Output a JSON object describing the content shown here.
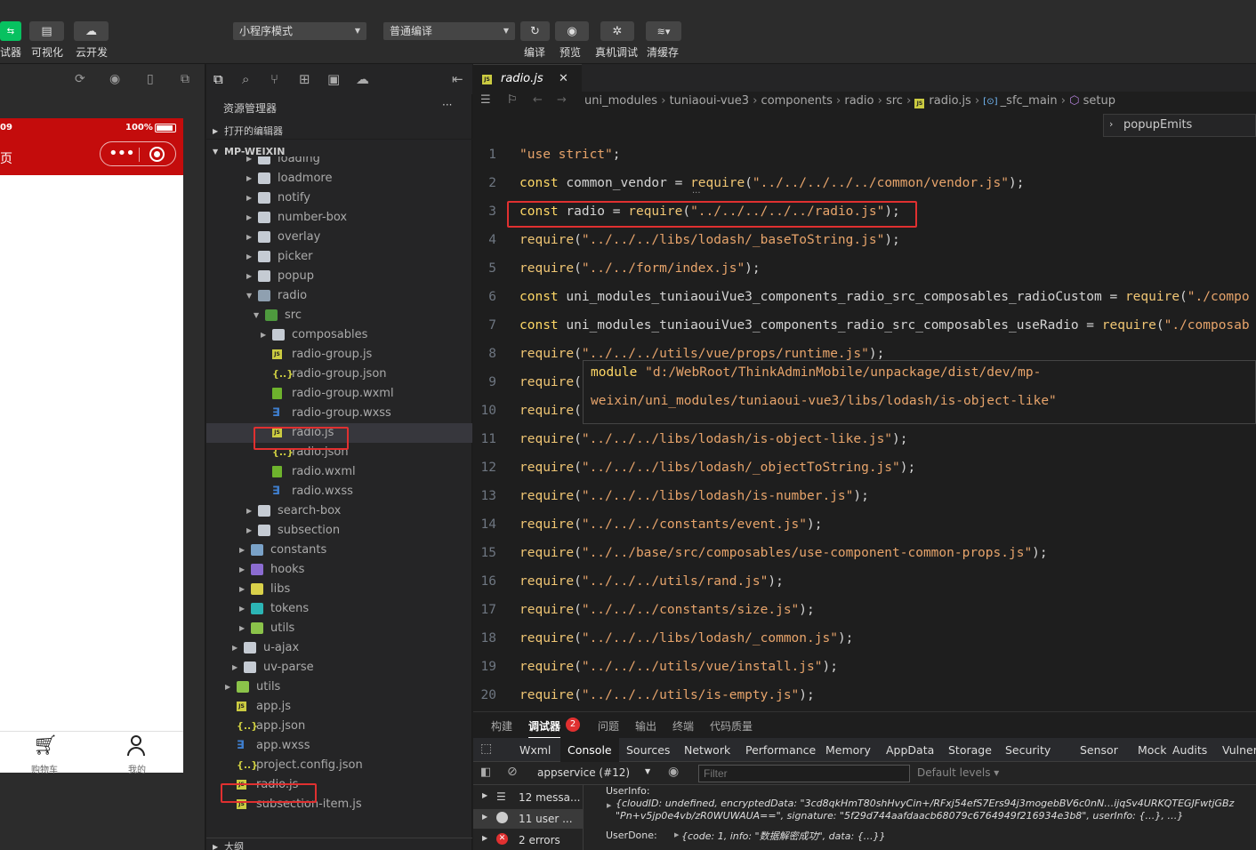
{
  "toolbar": {
    "left_cut_label": "试器",
    "visual_label": "可视化",
    "cloud_label": "云开发",
    "mode_select": "小程序模式",
    "compile_select": "普通编译",
    "compile_label": "编译",
    "preview_label": "预览",
    "remote_debug_label": "真机调试",
    "clear_cache_label": "清缓存"
  },
  "simulator": {
    "time": "09",
    "battery": "100%",
    "page_title": "页",
    "tab_cart_label": "购物车",
    "tab_mine_label": "我的"
  },
  "explorer": {
    "title": "资源管理器",
    "more": "···",
    "open_editors": "打开的编辑器",
    "root": "MP-WEIXIN",
    "items": [
      {
        "label": "loading",
        "type": "folder"
      },
      {
        "label": "loadmore",
        "type": "folder"
      },
      {
        "label": "notify",
        "type": "folder"
      },
      {
        "label": "number-box",
        "type": "folder"
      },
      {
        "label": "overlay",
        "type": "folder"
      },
      {
        "label": "picker",
        "type": "folder"
      },
      {
        "label": "popup",
        "type": "folder"
      },
      {
        "label": "radio",
        "type": "folder-open"
      },
      {
        "label": "src",
        "type": "folder-src"
      },
      {
        "label": "composables",
        "type": "folder"
      },
      {
        "label": "radio-group.js",
        "type": "js"
      },
      {
        "label": "radio-group.json",
        "type": "json"
      },
      {
        "label": "radio-group.wxml",
        "type": "wxml"
      },
      {
        "label": "radio-group.wxss",
        "type": "wxss"
      },
      {
        "label": "radio.js",
        "type": "js"
      },
      {
        "label": "radio.json",
        "type": "json"
      },
      {
        "label": "radio.wxml",
        "type": "wxml"
      },
      {
        "label": "radio.wxss",
        "type": "wxss"
      },
      {
        "label": "search-box",
        "type": "folder"
      },
      {
        "label": "subsection",
        "type": "folder"
      },
      {
        "label": "constants",
        "type": "folder-comp"
      },
      {
        "label": "hooks",
        "type": "folder-hooks"
      },
      {
        "label": "libs",
        "type": "folder-libs"
      },
      {
        "label": "tokens",
        "type": "folder-tokens"
      },
      {
        "label": "utils",
        "type": "folder-utils"
      },
      {
        "label": "u-ajax",
        "type": "folder"
      },
      {
        "label": "uv-parse",
        "type": "folder"
      },
      {
        "label": "utils",
        "type": "folder-utils"
      },
      {
        "label": "app.js",
        "type": "js"
      },
      {
        "label": "app.json",
        "type": "json"
      },
      {
        "label": "app.wxss",
        "type": "wxss"
      },
      {
        "label": "project.config.json",
        "type": "json"
      },
      {
        "label": "radio.js",
        "type": "js"
      },
      {
        "label": "subsection-item.js",
        "type": "js"
      }
    ],
    "bottom_section": "大纲"
  },
  "editor": {
    "tab_label": "radio.js",
    "tab_close": "✕",
    "breadcrumb": [
      "uni_modules",
      "tuniaoui-vue3",
      "components",
      "radio",
      "src",
      "radio.js",
      "_sfc_main",
      "setup"
    ],
    "peek_label": "popupEmits",
    "lines": [
      {
        "n": "1",
        "parts": [
          [
            "st",
            "\"use strict\""
          ],
          [
            "",
            ";"
          ]
        ]
      },
      {
        "n": "2",
        "parts": [
          [
            "kw",
            "const "
          ],
          [
            "",
            "common_vendor = "
          ],
          [
            "fn",
            "require"
          ],
          [
            "",
            "("
          ],
          [
            "st",
            "\"../../../../../common/vendor.js\""
          ],
          [
            "",
            ");"
          ]
        ]
      },
      {
        "n": "3",
        "parts": [
          [
            "kw",
            "const "
          ],
          [
            "",
            "radio = "
          ],
          [
            "fn",
            "require"
          ],
          [
            "",
            "("
          ],
          [
            "st",
            "\"../../../../../radio.js\""
          ],
          [
            "",
            ");"
          ]
        ]
      },
      {
        "n": "4",
        "parts": [
          [
            "fn",
            "require"
          ],
          [
            "",
            "("
          ],
          [
            "st",
            "\"../../../libs/lodash/_baseToString.js\""
          ],
          [
            "",
            ");"
          ]
        ]
      },
      {
        "n": "5",
        "parts": [
          [
            "fn",
            "require"
          ],
          [
            "",
            "("
          ],
          [
            "st",
            "\"../../form/index.js\""
          ],
          [
            "",
            ");"
          ]
        ]
      },
      {
        "n": "6",
        "parts": [
          [
            "kw",
            "const "
          ],
          [
            "",
            "uni_modules_tuniaouiVue3_components_radio_src_composables_radioCustom = "
          ],
          [
            "fn",
            "require"
          ],
          [
            "",
            "("
          ],
          [
            "st",
            "\"./compo"
          ]
        ]
      },
      {
        "n": "7",
        "parts": [
          [
            "kw",
            "const "
          ],
          [
            "",
            "uni_modules_tuniaouiVue3_components_radio_src_composables_useRadio = "
          ],
          [
            "fn",
            "require"
          ],
          [
            "",
            "("
          ],
          [
            "st",
            "\"./composab"
          ]
        ]
      },
      {
        "n": "8",
        "parts": [
          [
            "fn",
            "require"
          ],
          [
            "",
            "("
          ],
          [
            "st",
            "\"../../../utils/vue/props/runtime.js\""
          ],
          [
            "",
            ");"
          ]
        ]
      },
      {
        "n": "9",
        "parts": [
          [
            "fn",
            "require"
          ],
          [
            "",
            "("
          ]
        ]
      },
      {
        "n": "10",
        "parts": [
          [
            "fn",
            "require"
          ],
          [
            "",
            "("
          ]
        ]
      },
      {
        "n": "11",
        "parts": [
          [
            "fn",
            "require"
          ],
          [
            "",
            "("
          ],
          [
            "st",
            "\"../../../libs/lodash/is-object-like.js\""
          ],
          [
            "",
            ");"
          ]
        ]
      },
      {
        "n": "12",
        "parts": [
          [
            "fn",
            "require"
          ],
          [
            "",
            "("
          ],
          [
            "st",
            "\"../../../libs/lodash/_objectToString.js\""
          ],
          [
            "",
            ");"
          ]
        ]
      },
      {
        "n": "13",
        "parts": [
          [
            "fn",
            "require"
          ],
          [
            "",
            "("
          ],
          [
            "st",
            "\"../../../libs/lodash/is-number.js\""
          ],
          [
            "",
            ");"
          ]
        ]
      },
      {
        "n": "14",
        "parts": [
          [
            "fn",
            "require"
          ],
          [
            "",
            "("
          ],
          [
            "st",
            "\"../../../constants/event.js\""
          ],
          [
            "",
            ");"
          ]
        ]
      },
      {
        "n": "15",
        "parts": [
          [
            "fn",
            "require"
          ],
          [
            "",
            "("
          ],
          [
            "st",
            "\"../../base/src/composables/use-component-common-props.js\""
          ],
          [
            "",
            ");"
          ]
        ]
      },
      {
        "n": "16",
        "parts": [
          [
            "fn",
            "require"
          ],
          [
            "",
            "("
          ],
          [
            "st",
            "\"../../../utils/rand.js\""
          ],
          [
            "",
            ");"
          ]
        ]
      },
      {
        "n": "17",
        "parts": [
          [
            "fn",
            "require"
          ],
          [
            "",
            "("
          ],
          [
            "st",
            "\"../../../constants/size.js\""
          ],
          [
            "",
            ");"
          ]
        ]
      },
      {
        "n": "18",
        "parts": [
          [
            "fn",
            "require"
          ],
          [
            "",
            "("
          ],
          [
            "st",
            "\"../../../libs/lodash/_common.js\""
          ],
          [
            "",
            ");"
          ]
        ]
      },
      {
        "n": "19",
        "parts": [
          [
            "fn",
            "require"
          ],
          [
            "",
            "("
          ],
          [
            "st",
            "\"../../../utils/vue/install.js\""
          ],
          [
            "",
            ");"
          ]
        ]
      },
      {
        "n": "20",
        "parts": [
          [
            "fn",
            "require"
          ],
          [
            "",
            "("
          ],
          [
            "st",
            "\"../../../utils/is-empty.js\""
          ],
          [
            "",
            ");"
          ]
        ]
      }
    ],
    "hover": {
      "keyword": "module",
      "line1": "\"d:/WebRoot/ThinkAdminMobile/unpackage/dist/dev/mp-",
      "line2": "weixin/uni_modules/tuniaoui-vue3/libs/lodash/is-object-like\""
    }
  },
  "panel": {
    "tabs": [
      "构建",
      "调试器",
      "问题",
      "输出",
      "终端",
      "代码质量"
    ],
    "debugger_badge": "2",
    "devtools_tabs": [
      "Wxml",
      "Console",
      "Sources",
      "Network",
      "Performance",
      "Memory",
      "AppData",
      "Storage",
      "Security",
      "Sensor",
      "Mock",
      "Audits",
      "Vulnera"
    ],
    "context": "appservice (#12)",
    "filter_placeholder": "Filter",
    "levels": "Default levels ▾",
    "sidebar": [
      "12 messa...",
      "11 user ...",
      "2 errors"
    ],
    "log1_label": "UserInfo:",
    "log1_body1": "{cloudID: undefined, encryptedData: \"3cd8qkHmT80shHvyCin+/RFxj54efS7Ers94j3mogebBV6c0nN…ijqSv4URKQTEGJFwtjGBz",
    "log1_body2": "\"Pn+v5jp0e4vb/zR0WUWAUA==\", signature: \"5f29d744aafdaacb68079c6764949f216934e3b8\", userInfo: {…}, …}",
    "log2_label": "UserDone:",
    "log2_body": "{code: 1, info: \"数据解密成功\", data: {…}}"
  },
  "colors": {
    "accent_red": "#e03030",
    "wechat_green": "#07c160",
    "phone_header": "#c40c0c"
  }
}
